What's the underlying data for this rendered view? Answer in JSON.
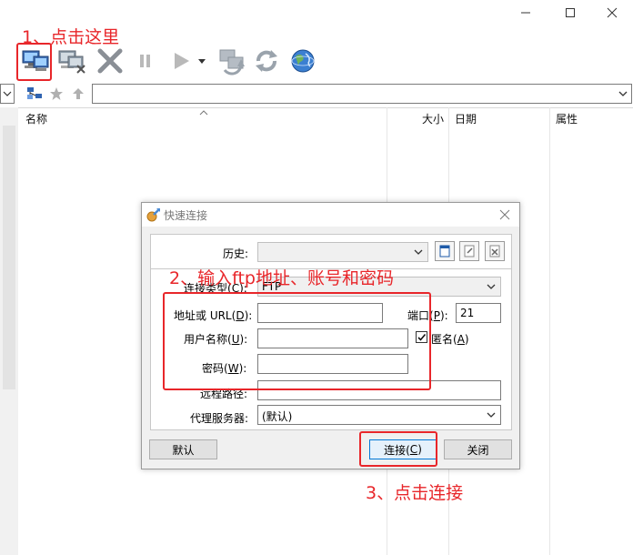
{
  "window": {
    "minimize_icon": "minimize-icon",
    "maximize_icon": "maximize-icon",
    "close_icon": "close-icon"
  },
  "toolbar": {
    "icons": [
      "connect-icon",
      "disconnect-icon",
      "delete-icon",
      "pause-icon",
      "play-icon",
      "dropdown-arrow-icon",
      "reconnect-icon",
      "refresh-icon",
      "globe-icon"
    ]
  },
  "columns": {
    "name": "名称",
    "size": "大小",
    "date": "日期",
    "attributes": "属性"
  },
  "dialog": {
    "title": "快速连接",
    "history_label": "历史:",
    "history_value": "",
    "conn_type_label_prefix": "连接类型(",
    "conn_type_key": "C",
    "conn_type_label_suffix": "):",
    "conn_type_value": "FTP",
    "address_label_prefix": "地址或 URL(",
    "address_key": "D",
    "address_label_suffix": "):",
    "address_value": "",
    "port_label_prefix": "端口(",
    "port_key": "P",
    "port_label_suffix": "):",
    "port_value": "21",
    "username_label_prefix": "用户名称(",
    "username_key": "U",
    "username_label_suffix": "):",
    "username_value": "",
    "anonymous_label_prefix": "匿名(",
    "anonymous_key": "A",
    "anonymous_label_suffix": ")",
    "anonymous_checked": true,
    "password_label_prefix": "密码(",
    "password_key": "W",
    "password_label_suffix": "):",
    "password_value": "",
    "remote_path_label": "远程路径:",
    "remote_path_value": "",
    "proxy_label": "代理服务器:",
    "proxy_value": "(默认)",
    "default_button": "默认",
    "connect_button_prefix": "连接(",
    "connect_key": "C",
    "connect_button_suffix": ")",
    "close_button": "关闭"
  },
  "annotations": {
    "step1": "1、点击这里",
    "step2": "2、输入ftp地址、账号和密码",
    "step3": "3、点击连接"
  },
  "colors": {
    "annotation": "#e8262a",
    "primary_border": "#0078d7"
  }
}
